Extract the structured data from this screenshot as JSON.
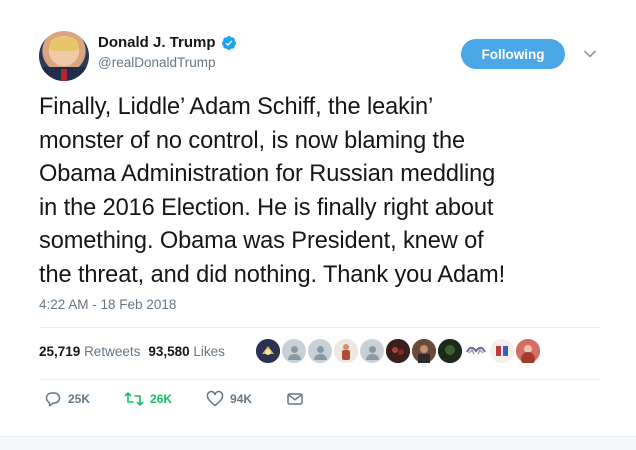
{
  "author": {
    "display_name": "Donald J. Trump",
    "handle": "@realDonaldTrump",
    "verified_icon": "verified-badge-icon"
  },
  "follow_button": {
    "label": "Following"
  },
  "tweet": {
    "lines": [
      "Finally, Liddle’ Adam Schiff, the leakin’",
      "monster of no control, is now blaming the",
      "Obama Administration for Russian meddling",
      "in the 2016 Election. He is finally right about",
      "something. Obama was President, knew of",
      "the threat, and did nothing. Thank you Adam!"
    ],
    "timestamp": "4:22 AM - 18 Feb 2018"
  },
  "stats": {
    "retweets_count": "25,719",
    "retweets_label": "Retweets",
    "likes_count": "93,580",
    "likes_label": "Likes"
  },
  "actions": {
    "reply_count": "25K",
    "retweet_count": "26K",
    "like_count": "94K"
  },
  "colors": {
    "accent": "#4aa8e8",
    "retweet_green": "#17bf63",
    "muted": "#657786"
  }
}
